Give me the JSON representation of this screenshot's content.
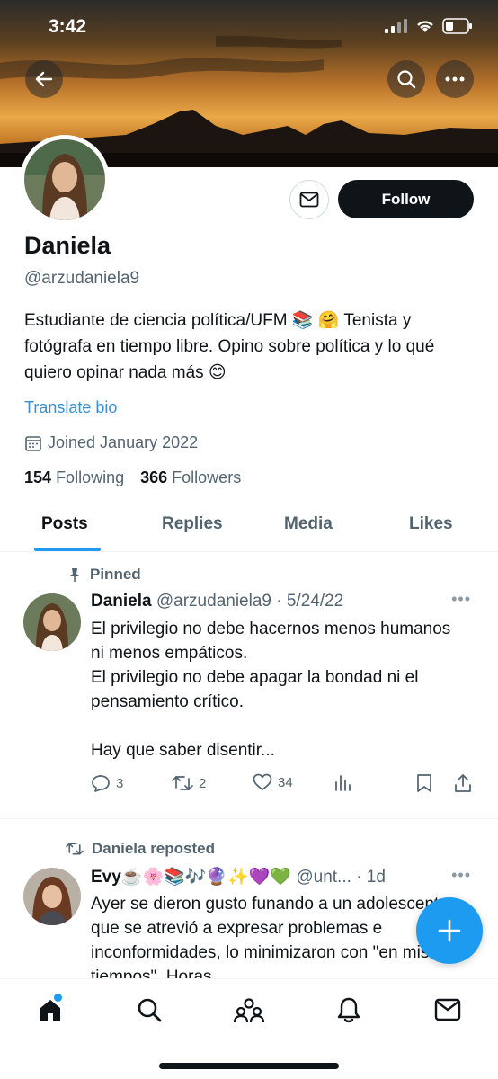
{
  "status_bar": {
    "time": "3:42"
  },
  "profile": {
    "name": "Daniela",
    "handle": "@arzudaniela9",
    "bio": "Estudiante de ciencia política/UFM 📚 🤗 Tenista y fotógrafa en tiempo libre. Opino sobre política y lo qué quiero opinar nada más 😊",
    "translate_label": "Translate bio",
    "joined": "Joined January 2022",
    "following_count": "154",
    "following_label": "Following",
    "followers_count": "366",
    "followers_label": "Followers",
    "follow_label": "Follow"
  },
  "tabs": [
    {
      "label": "Posts",
      "active": true
    },
    {
      "label": "Replies",
      "active": false
    },
    {
      "label": "Media",
      "active": false
    },
    {
      "label": "Likes",
      "active": false
    }
  ],
  "posts": [
    {
      "context": "Pinned",
      "name": "Daniela",
      "sub": "@arzudaniela9 · 5/24/22",
      "text": "El privilegio no debe hacernos menos humanos ni menos empáticos.\nEl privilegio no debe apagar la bondad ni el pensamiento crítico.\n\nHay que saber disentir...",
      "replies": "3",
      "reposts": "2",
      "likes": "34"
    },
    {
      "context": "Daniela reposted",
      "name": "Evy☕️🌸📚🎶🔮✨💜💚",
      "sub": "@unt... · 1d",
      "text": "Ayer se dieron gusto funando a un adolescente que se atrevió a expresar problemas e inconformidades, lo minimizaron con \"en mis tiempos\". Horas"
    }
  ],
  "colors": {
    "accent": "#1d9bf0",
    "link": "#3b8fd6",
    "text": "#0f1419",
    "muted": "#536471"
  }
}
